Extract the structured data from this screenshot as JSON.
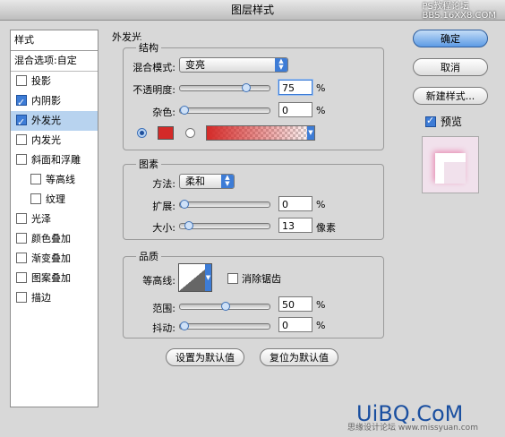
{
  "window": {
    "title": "图层样式",
    "watermark_top": "PS教程论坛\nBBS.16XX8.COM"
  },
  "sidebar": {
    "header": "样式",
    "blend_options": "混合选项:自定",
    "items": [
      {
        "label": "投影",
        "checked": false,
        "sub": false
      },
      {
        "label": "内阴影",
        "checked": true,
        "sub": false
      },
      {
        "label": "外发光",
        "checked": true,
        "sub": false,
        "selected": true
      },
      {
        "label": "内发光",
        "checked": false,
        "sub": false
      },
      {
        "label": "斜面和浮雕",
        "checked": false,
        "sub": false
      },
      {
        "label": "等高线",
        "checked": false,
        "sub": true
      },
      {
        "label": "纹理",
        "checked": false,
        "sub": true
      },
      {
        "label": "光泽",
        "checked": false,
        "sub": false
      },
      {
        "label": "颜色叠加",
        "checked": false,
        "sub": false
      },
      {
        "label": "渐变叠加",
        "checked": false,
        "sub": false
      },
      {
        "label": "图案叠加",
        "checked": false,
        "sub": false
      },
      {
        "label": "描边",
        "checked": false,
        "sub": false
      }
    ]
  },
  "outer_glow": {
    "title": "外发光",
    "structure": {
      "title": "结构",
      "blend_mode_label": "混合模式:",
      "blend_mode_value": "变亮",
      "opacity_label": "不透明度:",
      "opacity_value": "75",
      "opacity_level": 0.75,
      "noise_label": "杂色:",
      "noise_value": "0",
      "noise_level": 0,
      "unit": "%",
      "color_swatch": "#d42a28"
    },
    "elements": {
      "title": "图素",
      "technique_label": "方法:",
      "technique_value": "柔和",
      "spread_label": "扩展:",
      "spread_value": "0",
      "spread_level": 0,
      "size_label": "大小:",
      "size_value": "13",
      "size_level": 0.05,
      "unit_pct": "%",
      "unit_px": "像素"
    },
    "quality": {
      "title": "品质",
      "contour_label": "等高线:",
      "antialias_label": "消除锯齿",
      "range_label": "范围:",
      "range_value": "50",
      "range_level": 0.5,
      "jitter_label": "抖动:",
      "jitter_value": "0",
      "jitter_level": 0,
      "unit": "%"
    },
    "make_default": "设置为默认值",
    "reset_default": "复位为默认值"
  },
  "buttons": {
    "ok": "确定",
    "cancel": "取消",
    "new_style": "新建样式...",
    "preview": "预览"
  },
  "watermark_bottom": "UiBQ.CoM",
  "watermark_bottom_small": "思缘设计论坛 www.missyuan.com"
}
